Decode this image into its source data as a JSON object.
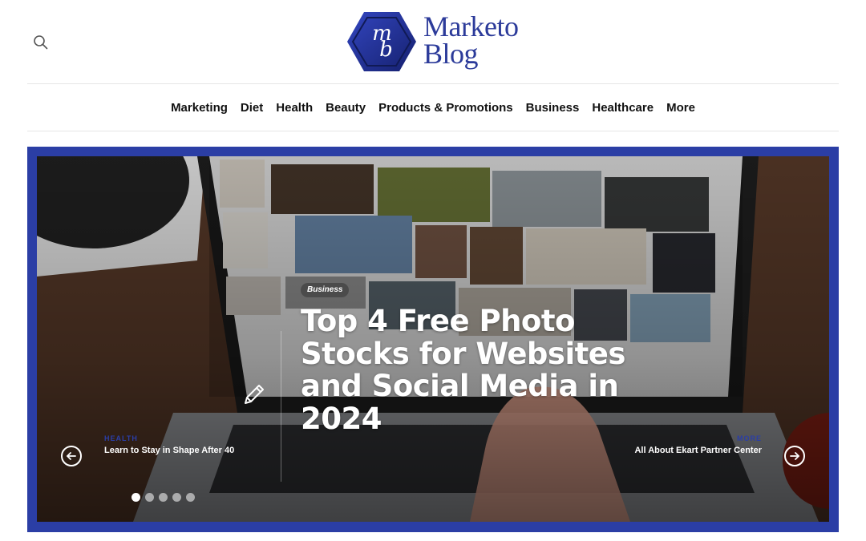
{
  "header": {
    "logo_monogram_top": "m",
    "logo_monogram_bottom": "b",
    "logo_line1": "Marketo",
    "logo_line2": "Blog",
    "search_icon": "search-icon",
    "brand_color": "#2c3b9a"
  },
  "nav": {
    "items": [
      "Marketing",
      "Diet",
      "Health",
      "Beauty",
      "Products & Promotions",
      "Business",
      "Healthcare",
      "More"
    ]
  },
  "hero": {
    "category": "Business",
    "title": "Top 4 Free Photo Stocks for Websites and Social Media in 2024",
    "prev_post": {
      "category": "HEALTH",
      "title": "Learn to Stay in Shape After 40"
    },
    "next_post": {
      "category": "MORE",
      "title": "All About Ekart Partner Center"
    },
    "slides": {
      "count": 5,
      "active": 1
    },
    "frame_color": "#2b3ea5",
    "icons": [
      "arrow-left-icon",
      "arrow-right-icon",
      "pencil-icon"
    ]
  }
}
